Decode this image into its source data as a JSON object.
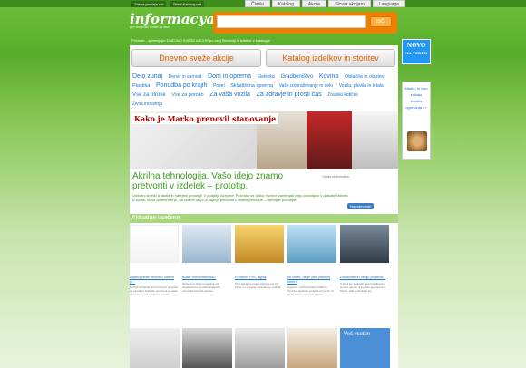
{
  "toplinks": [
    "Zbirna prodaja.net",
    "Zbirni Katalog.net"
  ],
  "topnav": [
    "Članki",
    "Katalog",
    "Akcije",
    "Slovar akcijam",
    "Language"
  ],
  "logo": "informacya.net",
  "logo_tagline": "prvi slovenski izdelki za dom",
  "search": {
    "placeholder": "",
    "button": "ISČI"
  },
  "intro": "Pričnate - spremljajte DNEVNO SVEŽE AKCIJE po vsej Sloveniji in izdelke v katalogu!",
  "main_buttons": [
    "Dnevno sveže akcije",
    "Katalog izdelkov in storitev"
  ],
  "tags": [
    "Delo zunaj",
    "Denar in varnost",
    "Dom in oprema",
    "Elektrika",
    "Gradbeništvo",
    "Kovina",
    "Oblačila in obutev",
    "Plastika",
    "Ponudba po krajih",
    "Posel",
    "Skladiščna oprema",
    "Vaše izobraževanje in delo",
    "Vozila, plovila in letala",
    "Vse za otroke",
    "Vse za poroko",
    "Za vaša vozila",
    "Za zdravje in prosti čas",
    "Živalski kotiček",
    "Živila industrija"
  ],
  "banner": {
    "title": "Kako je Marko prenovil stanovanje"
  },
  "article": {
    "title": "Akrilna tehnologija. Vašo idejo znamo pretvoriti v izdelek – prototip.",
    "text": "Unikatni izdelki iz akrila in narejeni prototipi! V podjetju Acrylech Pečenko se lahko »tvoro« zamenjati idejo prototipov v unikatni izdelek iz Akrila. Naša posebnost je, da znamo idejo iz papirja pretvoriti v realne produkte – razvojne prototipe.",
    "more": "Nadaljevanje",
    "dots_label": "Ostala obdelovalne:"
  },
  "aktual": "Aktualne vsebine",
  "cards": [
    {
      "link": "Najbolj varen dimniški sistem je...",
      "text": "Dimniki Schiedel vsi kot plus je pripeval za vgradnjo. Naložite prednosti je veliko varnosti in proti učinkovit uporabi."
    },
    {
      "link": "Bolite zobozdravnika?",
      "text": "Strokovno, fleks in ugodna zdr standardnih in mobilizacijakskih zobozdravstvenih storitev."
    },
    {
      "link": "Predmoti PVC agraji",
      "text": "PVC agraji ne trajno odporne na UV žarke in ne rjavijo ohranaivajo optimal."
    },
    {
      "link": "Ali veste, da je nalo plastenj mehri.",
      "text": "Pogovor s strokovnjakom Mitkom Ocvirko, tajnikom podjetja Acrytech. Ki so že preko preporodi plastike."
    },
    {
      "link": "Učinkovita in okolju prijazna...",
      "text": "Iz žiteli leo sodelnih garol konjibarvni lesnimi glovon ni pet Slovgozi lesnimi Pohibi. Zaboj učinkovit les."
    }
  ],
  "sidebar": {
    "novo": "NOVO",
    "novo_sub": "NA TEDEN",
    "ad_lines": [
      "Mislim, ki vam",
      "znižajo",
      "stroške",
      "ogrevanja >>"
    ]
  },
  "more_content": "Več vsebin"
}
